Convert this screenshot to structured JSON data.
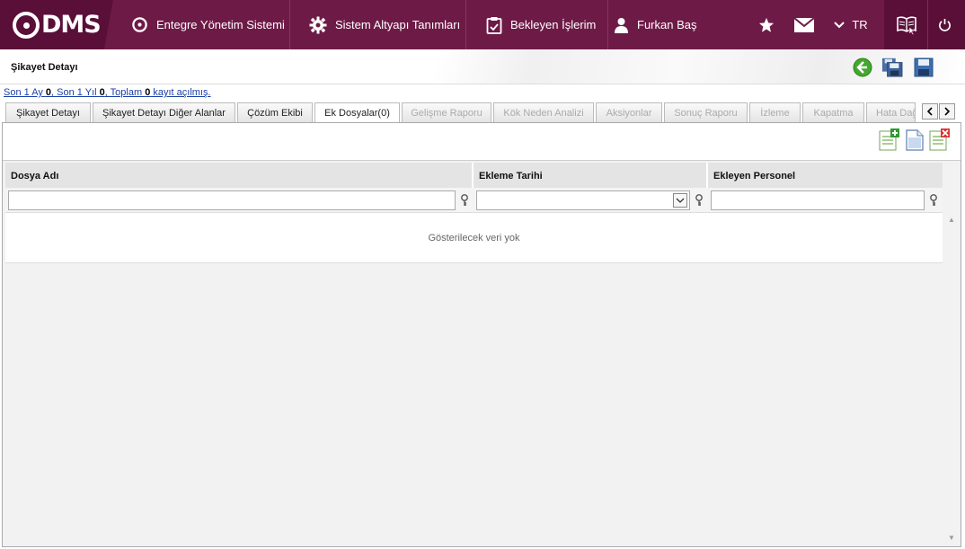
{
  "brand": {
    "logo_text": "DMS"
  },
  "nav": {
    "items": [
      {
        "label": "Entegre Yönetim Sistemi",
        "icon": "qdms-icon"
      },
      {
        "label": "Sistem Altyapı Tanımları",
        "icon": "gear-icon"
      },
      {
        "label": "Bekleyen İşlerim",
        "icon": "clipboard-icon"
      },
      {
        "label": "Furkan Baş",
        "icon": "user-icon"
      }
    ],
    "language": "TR"
  },
  "page": {
    "title": "Şikayet Detayı",
    "summary": {
      "prefix1": "Son 1 Ay ",
      "count1": "0",
      "prefix2": ", Son 1 Yıl ",
      "count2": "0",
      "prefix3": ", Toplam ",
      "count3": "0",
      "suffix": " kayıt açılmış."
    }
  },
  "tabs": [
    {
      "label": "Şikayet Detayı",
      "state": "normal"
    },
    {
      "label": "Şikayet Detayı Diğer Alanlar",
      "state": "normal"
    },
    {
      "label": "Çözüm Ekibi",
      "state": "normal"
    },
    {
      "label": "Ek Dosyalar(0)",
      "state": "active"
    },
    {
      "label": "Gelişme Raporu",
      "state": "disabled"
    },
    {
      "label": "Kök Neden Analizi",
      "state": "disabled"
    },
    {
      "label": "Aksiyonlar",
      "state": "disabled"
    },
    {
      "label": "Sonuç Raporu",
      "state": "disabled"
    },
    {
      "label": "İzleme",
      "state": "disabled"
    },
    {
      "label": "Kapatma",
      "state": "disabled"
    },
    {
      "label": "Hata Dağ",
      "state": "disabled"
    }
  ],
  "grid": {
    "columns": [
      "Dosya Adı",
      "Ekleme Tarihi",
      "Ekleyen Personel"
    ],
    "empty_text": "Gösterilecek veri yok"
  },
  "colors": {
    "brand": "#6e1a47",
    "brand_dark": "#5a0f38"
  }
}
